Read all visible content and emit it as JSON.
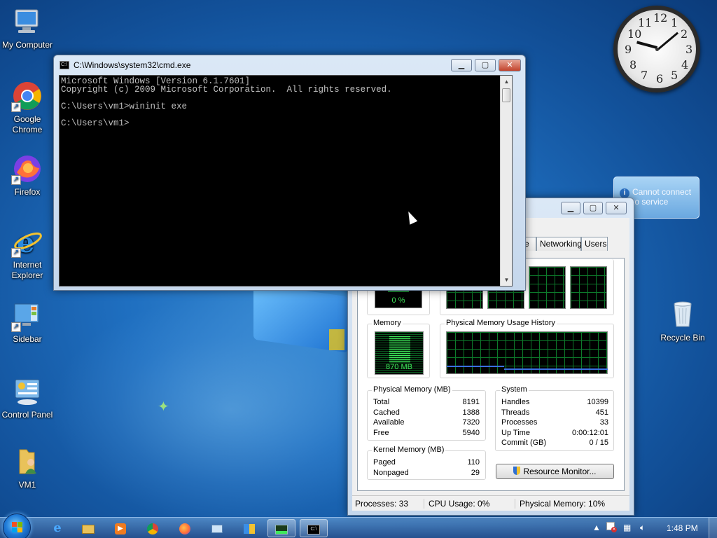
{
  "desktop": {
    "icons": [
      {
        "label": "My Computer"
      },
      {
        "label": "Google Chrome"
      },
      {
        "label": "Firefox"
      },
      {
        "label": "Internet Explorer"
      },
      {
        "label": "Sidebar"
      },
      {
        "label": "Control Panel"
      },
      {
        "label": "VM1"
      },
      {
        "label": "Recycle Bin"
      }
    ]
  },
  "clock_gadget": {
    "numbers": [
      "12",
      "1",
      "2",
      "3",
      "4",
      "5",
      "6",
      "7",
      "8",
      "9",
      "10",
      "11"
    ]
  },
  "weather_gadget": {
    "line1": "Cannot connect",
    "line2": "to service"
  },
  "cmd": {
    "title": "C:\\Windows\\system32\\cmd.exe",
    "lines": [
      "Microsoft Windows [Version 6.1.7601]",
      "Copyright (c) 2009 Microsoft Corporation.  All rights reserved.",
      "",
      "C:\\Users\\vm1>wininit exe",
      "",
      "C:\\Users\\vm1>"
    ]
  },
  "taskmgr": {
    "tabs": [
      "e",
      "Networking",
      "Users"
    ],
    "cpu_meter_value": "0 %",
    "memory_label": "Memory",
    "memory_meter_value": "870 MB",
    "memory_history_label": "Physical Memory Usage History",
    "physical_memory": {
      "label": "Physical Memory (MB)",
      "rows": [
        {
          "k": "Total",
          "v": "8191"
        },
        {
          "k": "Cached",
          "v": "1388"
        },
        {
          "k": "Available",
          "v": "7320"
        },
        {
          "k": "Free",
          "v": "5940"
        }
      ]
    },
    "kernel_memory": {
      "label": "Kernel Memory (MB)",
      "rows": [
        {
          "k": "Paged",
          "v": "110"
        },
        {
          "k": "Nonpaged",
          "v": "29"
        }
      ]
    },
    "system": {
      "label": "System",
      "rows": [
        {
          "k": "Handles",
          "v": "10399"
        },
        {
          "k": "Threads",
          "v": "451"
        },
        {
          "k": "Processes",
          "v": "33"
        },
        {
          "k": "Up Time",
          "v": "0:00:12:01"
        },
        {
          "k": "Commit (GB)",
          "v": "0 / 15"
        }
      ]
    },
    "resource_monitor_button": "Resource Monitor...",
    "status": {
      "processes": "Processes: 33",
      "cpu": "CPU Usage: 0%",
      "memory": "Physical Memory: 10%"
    }
  },
  "taskbar": {
    "time": "1:48 PM"
  }
}
